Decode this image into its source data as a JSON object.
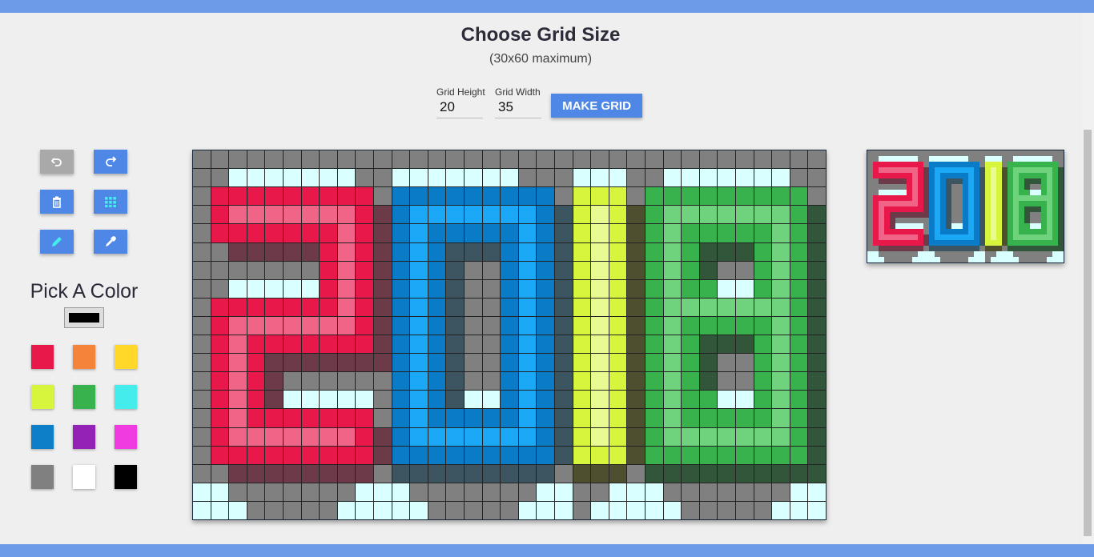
{
  "header": {
    "title": "Choose Grid Size",
    "subtitle": "(30x60 maximum)"
  },
  "grid_controls": {
    "height_label": "Grid Height",
    "height_value": "20",
    "width_label": "Grid Width",
    "width_value": "35",
    "make_grid_label": "MAKE GRID"
  },
  "tools": [
    {
      "name": "undo",
      "icon": "undo-icon",
      "disabled": true
    },
    {
      "name": "redo",
      "icon": "redo-icon",
      "disabled": false
    },
    {
      "name": "clear",
      "icon": "trash-icon",
      "disabled": false
    },
    {
      "name": "toggle-grid",
      "icon": "grid-icon",
      "disabled": false
    },
    {
      "name": "pencil",
      "icon": "pencil-icon",
      "disabled": false
    },
    {
      "name": "eyedropper",
      "icon": "eyedropper-icon",
      "disabled": false
    }
  ],
  "palette": {
    "title": "Pick A Color",
    "current_color": "#000000",
    "swatches": [
      "#e8194a",
      "#f5843a",
      "#ffd82a",
      "#d6f53c",
      "#37b24d",
      "#45ecec",
      "#0c7fc8",
      "#9422b6",
      "#ef3be0",
      "#808080",
      "#ffffff",
      "#000000"
    ]
  },
  "pixel_art": {
    "rows": 20,
    "cols": 35,
    "legend": {
      "G": "#808080",
      "C": "#d9ffff",
      "R": "#e8194a",
      "P": "#f06587",
      "M": "#6d3a4a",
      "B": "#0a7bc6",
      "L": "#1aa8f7",
      "S": "#3d5560",
      "Y": "#d6f53c",
      "y": "#e8fb92",
      "O": "#4e4f2e",
      "D": "#37b24d",
      "E": "#6fd27c",
      "K": "#32563a"
    },
    "cells": [
      "GGGGGGGGGGGGGGGGGGGGGGGGGGGGGGGGGGG",
      "GGCCCCCCCGGCCCCCCCGGGCCCGGCCCCCCCGG",
      "GRRRRRRRRRGBBBBBBBBBGYYYGDDDDDDDDDG",
      "GRPPPPPPPRMBLLLLLLLBSYyYODEEEEEEEDK",
      "GRRRRRRRPRMBLBBBBBLBSYyYODEDDDDDEDK",
      "GGMMMMMRPRMBLBSSSBLBSYyYODEDKKKDEDK",
      "GGGGGGGRPRMBLBSGGBLBSYyYODEDKGGDEDK",
      "GGCCCCCRPRMBLBSGGBLBSYyYODEDDCCDEDK",
      "GRRRRRRRPRMBLBSGGBLBSYyYODEEEEEEEDK",
      "GRPPPPPPPRMBLBSGGBLBSYyYODEDDDDDEDK",
      "GRPRRRRRRRMBLBSGGBLBSYyYODEDKKKDEDK",
      "GRPRMMMMMMMBLBSGGBLBSYyYODEDKGGDEDK",
      "GRPRMGGGGGGBLBSGGBLBSYyYODEDKGGDEDK",
      "GRPRMCCCCCGBLBSCCBLBSYyYODEDDCCDEDK",
      "GRPRRRRRRRGBLBBBBBLBSYyYODEDDDDDEDK",
      "GRPPPPPPPRMBLLLLLLLBSYyYODEEEEEEEDK",
      "GRRRRRRRRRMBBBBBBBBBSYYYODDDDDDDDDK",
      "GGMMMMMMMMGSSSSSSSSSGOOOGKKKKKKKKKK",
      "CCGGGGGGGCCCGGGGGGGCCGGCCCGGGGGGGCC",
      "CCCGGGGGCCCCCGGGGGCCCGCCCCCGGGGGCCC"
    ]
  }
}
